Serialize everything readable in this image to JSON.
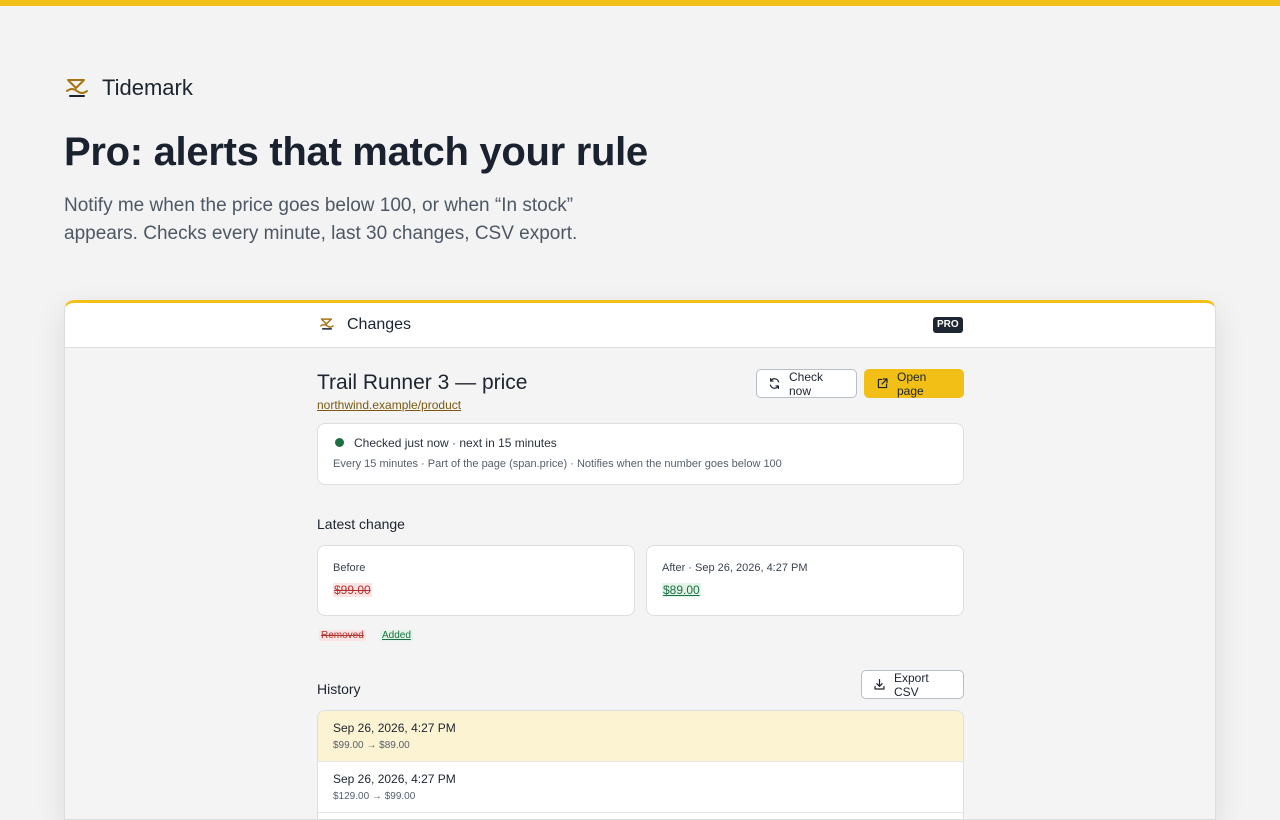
{
  "brand": {
    "name": "Tidemark"
  },
  "hero": {
    "title": "Pro: alerts that match your rule",
    "subtitle": "Notify me when the price goes below 100, or when “In stock” appears. Checks every minute, last 30 changes, CSV export."
  },
  "colors": {
    "accent": "#f2c018",
    "removed": "#b2322e",
    "added": "#1f6f45",
    "status_ok": "#1f6f45"
  },
  "panel": {
    "title": "Changes",
    "badge": "PRO",
    "monitor": {
      "title": "Trail Runner 3 — price",
      "url": "northwind.example/product",
      "check_now_label": "Check now",
      "open_page_label": "Open page"
    },
    "status": {
      "line": "Checked just now · next in 15 minutes",
      "detail": "Every 15 minutes · Part of the page (span.price) · Notifies when the number goes below 100"
    },
    "latest_change": {
      "label": "Latest change",
      "before_label": "Before",
      "before_value": "$99.00",
      "after_label": "After · Sep 26, 2026, 4:27 PM",
      "after_value": "$89.00",
      "legend_removed": "Removed",
      "legend_added": "Added"
    },
    "history": {
      "label": "History",
      "export_label": "Export CSV",
      "rows": [
        {
          "date": "Sep 26, 2026, 4:27 PM",
          "change": "$99.00 → $89.00"
        },
        {
          "date": "Sep 26, 2026, 4:27 PM",
          "change": "$129.00 → $99.00"
        }
      ]
    }
  }
}
